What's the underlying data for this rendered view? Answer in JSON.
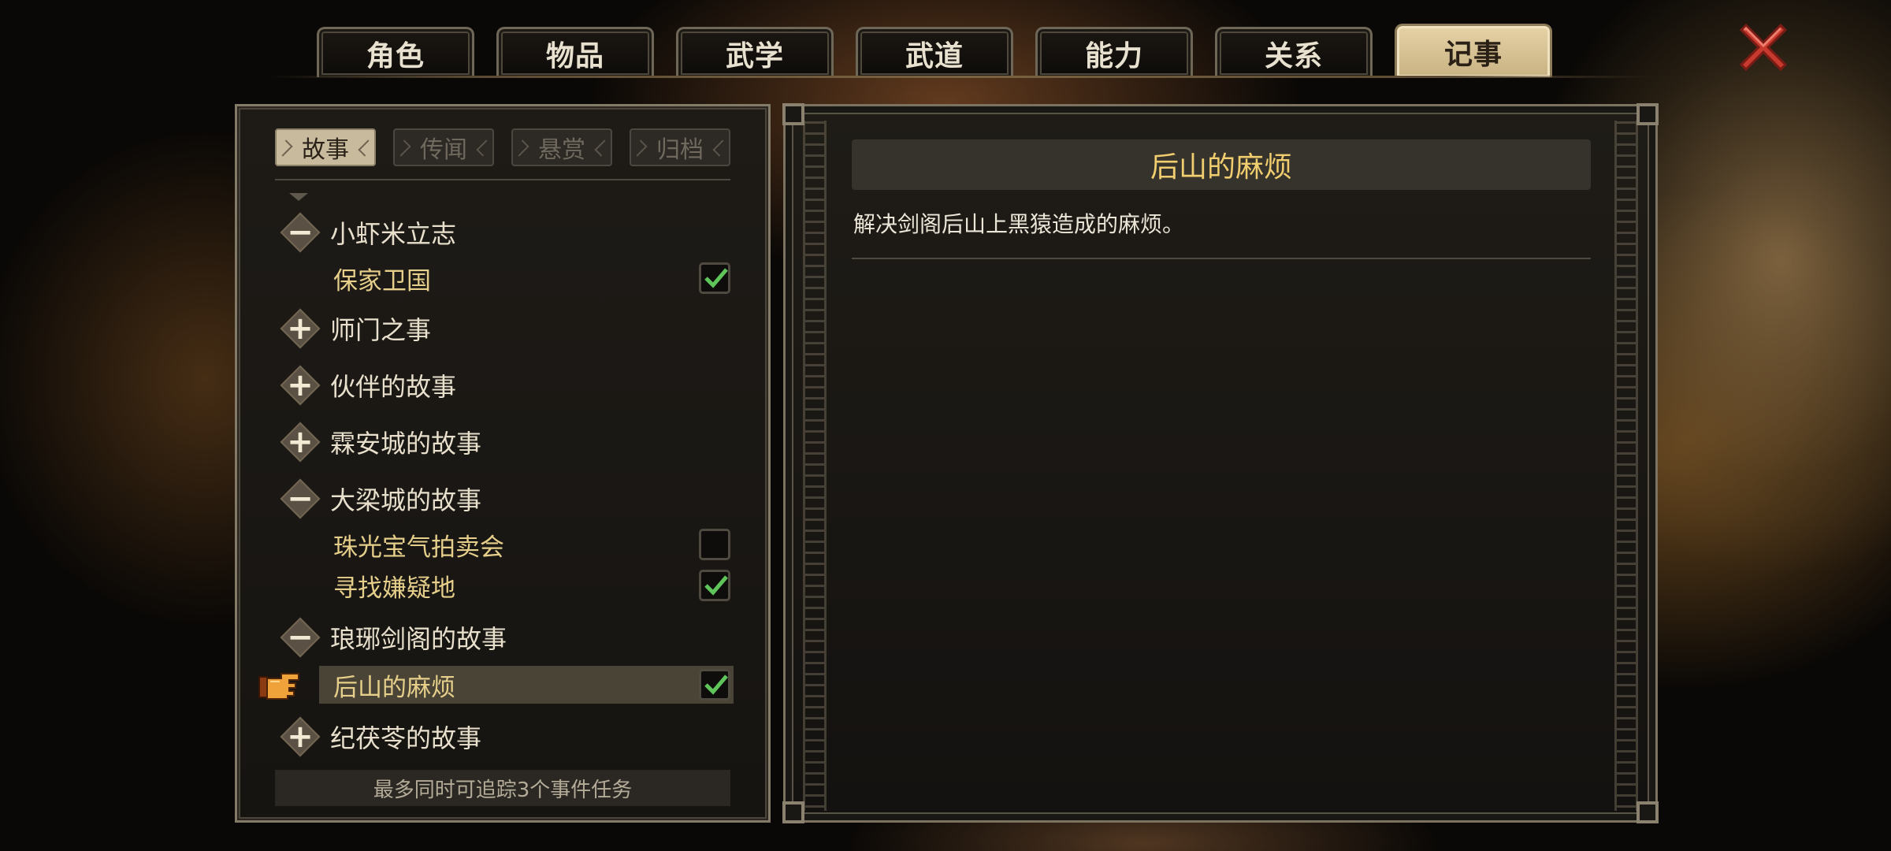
{
  "top_tabs": [
    "角色",
    "物品",
    "武学",
    "武道",
    "能力",
    "关系",
    "记事"
  ],
  "active_top_tab": "记事",
  "sub_tabs": [
    "故事",
    "传闻",
    "悬赏",
    "归档"
  ],
  "active_sub_tab": "故事",
  "tree": {
    "groups": [
      {
        "label": "小虾米立志",
        "expanded": true,
        "toggle": "−",
        "quests": [
          {
            "label": "保家卫国",
            "completed": true
          }
        ]
      },
      {
        "label": "师门之事",
        "expanded": false,
        "toggle": "+",
        "quests": []
      },
      {
        "label": "伙伴的故事",
        "expanded": false,
        "toggle": "+",
        "quests": []
      },
      {
        "label": "霖安城的故事",
        "expanded": false,
        "toggle": "+",
        "quests": []
      },
      {
        "label": "大梁城的故事",
        "expanded": true,
        "toggle": "−",
        "quests": [
          {
            "label": "珠光宝气拍卖会",
            "completed": false
          },
          {
            "label": "寻找嫌疑地",
            "completed": true
          }
        ]
      },
      {
        "label": "琅琊剑阁的故事",
        "expanded": true,
        "toggle": "−",
        "quests": [
          {
            "label": "后山的麻烦",
            "completed": true,
            "selected": true
          }
        ]
      },
      {
        "label": "纪茯苓的故事",
        "expanded": false,
        "toggle": "+",
        "quests": []
      }
    ]
  },
  "track_note": "最多同时可追踪3个事件任务",
  "detail": {
    "title": "后山的麻烦",
    "description": "解决剑阁后山上黑猿造成的麻烦。"
  },
  "colors": {
    "active_tab": "#d8c496",
    "title_gold": "#f0cd6e",
    "quest_gold": "#e6cf8a",
    "check_green": "#5fc45a",
    "close_red": "#c93a2e"
  },
  "icons": {
    "close": "close-icon",
    "toggle_expand": "plus-icon",
    "toggle_collapse": "minus-icon",
    "pointer": "pointing-hand-icon",
    "check": "checkmark-icon"
  }
}
